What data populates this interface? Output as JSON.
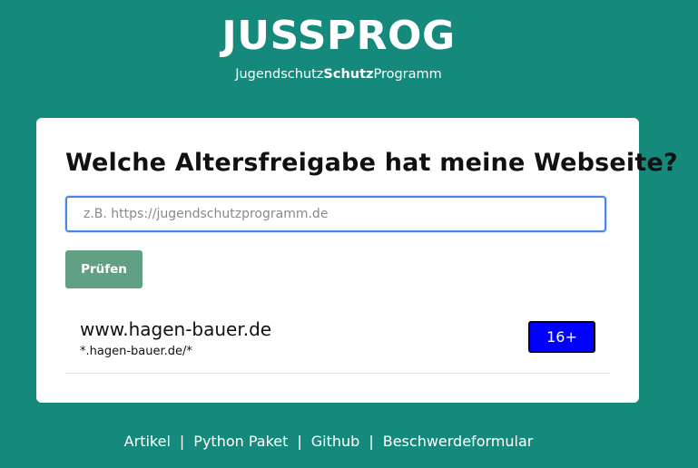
{
  "header": {
    "title": "JUSSPROG",
    "subtitle_part1": "Jugendschutz",
    "subtitle_part2": "Schutz",
    "subtitle_part3": "Programm"
  },
  "main": {
    "heading": "Welche Altersfreigabe hat meine Webseite?",
    "url_input": {
      "value": "",
      "placeholder": "z.B. https://jugendschutzprogramm.de"
    },
    "check_button_label": "Prüfen",
    "results": [
      {
        "domain": "www.hagen-bauer.de",
        "pattern": "*.hagen-bauer.de/*",
        "age_rating": "16+"
      }
    ]
  },
  "footer": {
    "links": [
      "Artikel",
      "Python Paket",
      "Github",
      "Beschwerdeformular"
    ],
    "separator": "|"
  },
  "colors": {
    "background": "#158a7c",
    "card": "#ffffff",
    "button": "#62a084",
    "input_focus_border": "#4a86e8",
    "age_badge": "#0000ff"
  }
}
